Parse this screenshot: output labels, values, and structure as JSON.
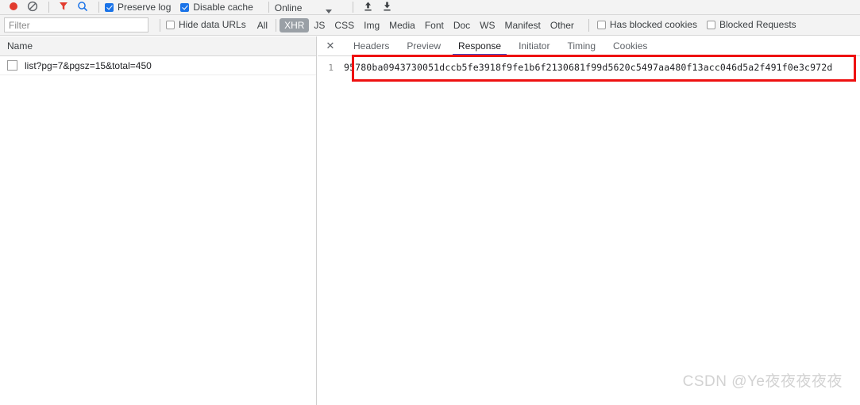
{
  "toolbar": {
    "icons": [
      {
        "name": "record-button",
        "glyph": "record"
      },
      {
        "name": "clear-button",
        "glyph": "clear"
      },
      {
        "name": "filter-icon",
        "glyph": "funnel"
      },
      {
        "name": "search-icon",
        "glyph": "magnifier"
      }
    ],
    "preserve_log": {
      "label": "Preserve log",
      "checked": true
    },
    "disable_cache": {
      "label": "Disable cache",
      "checked": true
    },
    "throttle": {
      "label": "Online"
    },
    "import_icon": "upload-icon",
    "export_icon": "download-icon"
  },
  "filterbar": {
    "filter_placeholder": "Filter",
    "filter_value": "",
    "hide_data_urls": {
      "label": "Hide data URLs",
      "checked": false
    },
    "types": [
      {
        "label": "All",
        "active": false
      },
      {
        "label": "XHR",
        "active": true
      },
      {
        "label": "JS",
        "active": false
      },
      {
        "label": "CSS",
        "active": false
      },
      {
        "label": "Img",
        "active": false
      },
      {
        "label": "Media",
        "active": false
      },
      {
        "label": "Font",
        "active": false
      },
      {
        "label": "Doc",
        "active": false
      },
      {
        "label": "WS",
        "active": false
      },
      {
        "label": "Manifest",
        "active": false
      },
      {
        "label": "Other",
        "active": false
      }
    ],
    "has_blocked_cookies": {
      "label": "Has blocked cookies",
      "checked": false
    },
    "blocked_requests": {
      "label": "Blocked Requests",
      "checked": false
    }
  },
  "requests": {
    "column_header": "Name",
    "rows": [
      {
        "name": "list?pg=7&pgsz=15&total=450"
      }
    ]
  },
  "detail": {
    "close_glyph": "✕",
    "tabs": [
      {
        "label": "Headers",
        "active": false
      },
      {
        "label": "Preview",
        "active": false
      },
      {
        "label": "Response",
        "active": true
      },
      {
        "label": "Initiator",
        "active": false
      },
      {
        "label": "Timing",
        "active": false
      },
      {
        "label": "Cookies",
        "active": false
      }
    ],
    "response": {
      "line_number": "1",
      "content": "95780ba0943730051dccb5fe3918f9fe1b6f2130681f99d5620c5497aa480f13acc046d5a2f491f0e3c972d"
    }
  },
  "annotation": {
    "color": "#ee1111"
  },
  "watermark": {
    "text": "CSDN @Ye夜夜夜夜夜"
  }
}
